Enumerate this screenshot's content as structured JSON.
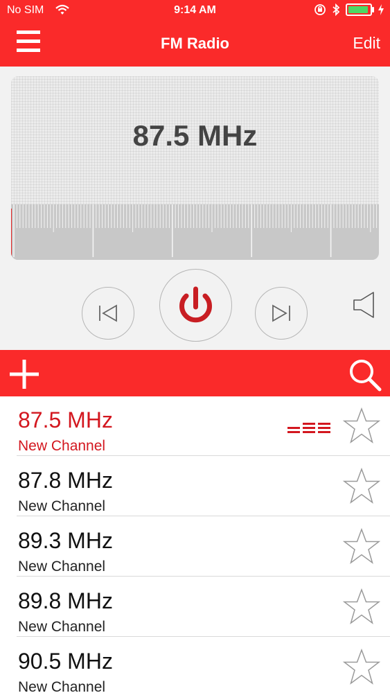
{
  "status_bar": {
    "carrier": "No SIM",
    "time": "9:14 AM"
  },
  "nav": {
    "title": "FM Radio",
    "menu_icon": "hamburger-icon",
    "edit_label": "Edit"
  },
  "tuner": {
    "frequency": "87.5 MHz",
    "needle_position": 0.0
  },
  "controls": {
    "prev_icon": "skip-previous-icon",
    "power_icon": "power-icon",
    "next_icon": "skip-next-icon",
    "volume_icon": "speaker-icon"
  },
  "action_bar": {
    "add_icon": "plus-icon",
    "search_icon": "search-icon"
  },
  "channels": [
    {
      "frequency": "87.5 MHz",
      "name": "New Channel",
      "playing": true,
      "favorite": false
    },
    {
      "frequency": "87.8 MHz",
      "name": "New Channel",
      "playing": false,
      "favorite": false
    },
    {
      "frequency": "89.3 MHz",
      "name": "New Channel",
      "playing": false,
      "favorite": false
    },
    {
      "frequency": "89.8 MHz",
      "name": "New Channel",
      "playing": false,
      "favorite": false
    },
    {
      "frequency": "90.5 MHz",
      "name": "New Channel",
      "playing": false,
      "favorite": false
    }
  ],
  "colors": {
    "accent": "#fa2a2a",
    "active_text": "#d3171f",
    "power_icon": "#c81e23"
  }
}
